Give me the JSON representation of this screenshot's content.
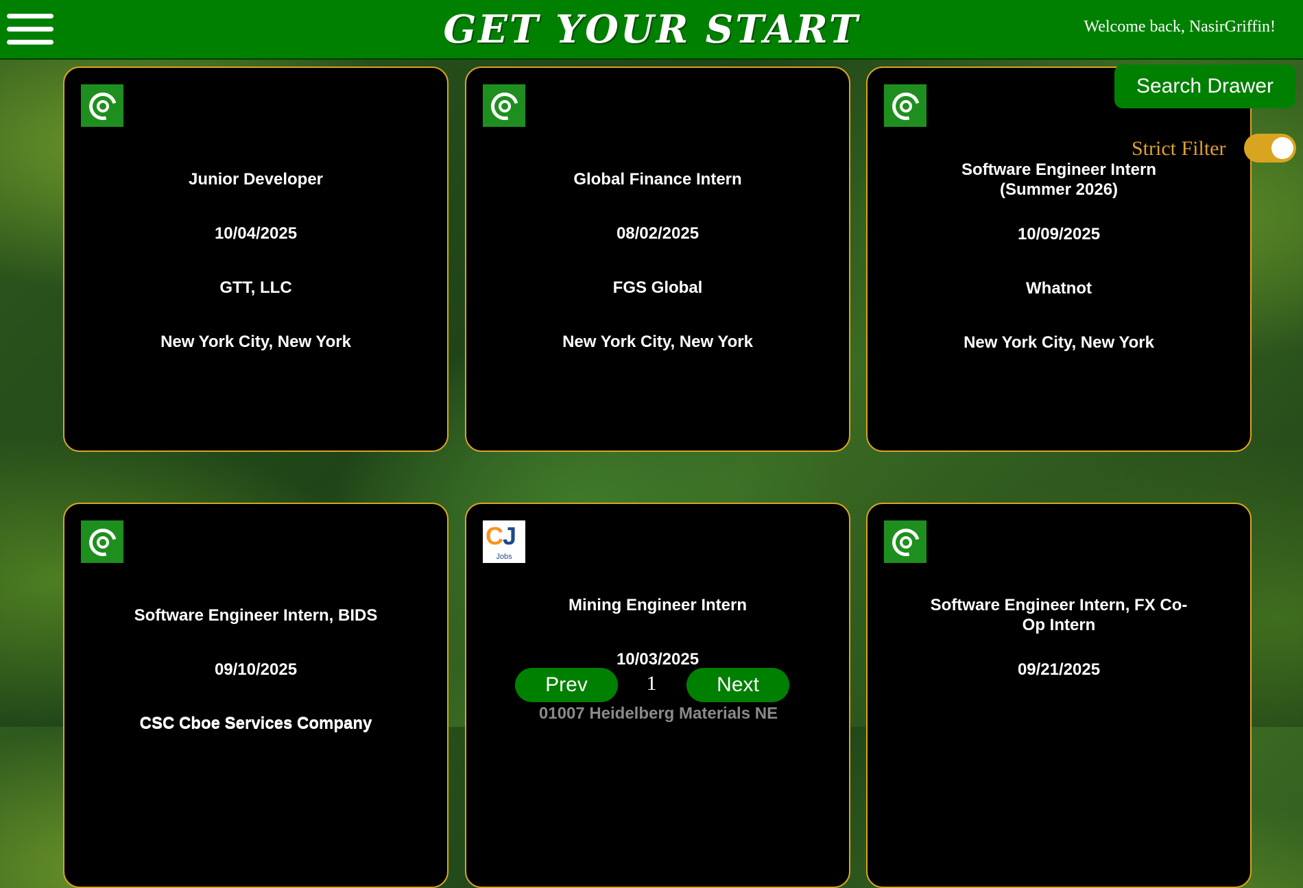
{
  "header": {
    "menu_icon": "hamburger-menu-icon",
    "title": "GET YOUR START",
    "welcome": "Welcome back, NasirGriffin!"
  },
  "controls": {
    "search_drawer": "Search Drawer",
    "strict_filter_label": "Strict Filter",
    "strict_filter_on": true
  },
  "cards": [
    {
      "title": "Junior Developer",
      "date": "10/04/2025",
      "company": "GTT, LLC",
      "location": "New York City, New York",
      "logo": "spiral-logo-icon"
    },
    {
      "title": "Global Finance Intern",
      "date": "08/02/2025",
      "company": "FGS Global",
      "location": "New York City, New York",
      "logo": "spiral-logo-icon"
    },
    {
      "title": "Software Engineer Intern (Summer 2026)",
      "date": "10/09/2025",
      "company": "Whatnot",
      "location": "New York City, New York",
      "logo": "spiral-logo-icon"
    },
    {
      "title": "Software Engineer Intern, BIDS",
      "date": "09/10/2025",
      "company": "CSC Cboe Services Company",
      "location": "",
      "logo": "spiral-logo-icon"
    },
    {
      "title": "Mining Engineer Intern",
      "date": "10/03/2025",
      "company": "01007 Heidelberg Materials NE",
      "location": "",
      "logo": "cj-jobs-logo-icon",
      "logo_text": "CJ",
      "logo_sub": "Jobs"
    },
    {
      "title": "Software Engineer Intern, FX Co-Op Intern",
      "date": "09/21/2025",
      "company": "",
      "location": "",
      "logo": "spiral-logo-icon"
    }
  ],
  "pagination": {
    "prev": "Prev",
    "page": "1",
    "next": "Next"
  },
  "colors": {
    "header_bg": "#008000",
    "card_border": "#d9a520",
    "card_bg": "#000000",
    "toggle_on": "#d9a520"
  }
}
